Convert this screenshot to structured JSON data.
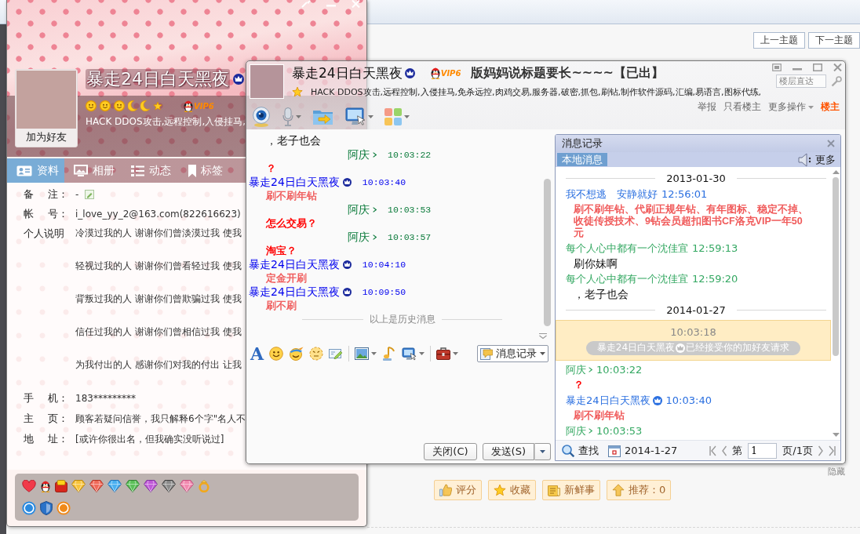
{
  "forum": {
    "nav_buttons": [
      {
        "label": "上一主题"
      },
      {
        "label": "下一主题"
      }
    ],
    "thread_title": "版妈妈说标题要长~~~~【已出】",
    "floor_jump": {
      "placeholder": "楼层直达"
    },
    "post_actions": [
      {
        "kind": "link",
        "label": "举报"
      },
      {
        "kind": "link",
        "label": "只看楼主"
      },
      {
        "kind": "menu",
        "label": "更多操作"
      },
      {
        "kind": "tag",
        "label": "楼主"
      }
    ],
    "hide_link": "隐藏",
    "action_buttons": [
      {
        "label": "评分"
      },
      {
        "label": "收藏"
      },
      {
        "label": "新鲜事"
      },
      {
        "label": "推荐：0"
      }
    ]
  },
  "profile": {
    "name": "暴走24日白天黑夜",
    "name_mark": true,
    "vip": "VIP6",
    "signature": "HACK DDOS攻击,远程控制,入侵挂马,",
    "add_friend": "加为好友",
    "tabs": [
      {
        "label": "资料",
        "selected": true
      },
      {
        "label": "相册",
        "selected": false
      },
      {
        "label": "动态",
        "selected": false
      },
      {
        "label": "标签",
        "selected": false
      }
    ],
    "fields": [
      {
        "kind": "remark",
        "label": "备 注：",
        "value": "-"
      },
      {
        "kind": "text",
        "label": "帐 号：",
        "value": "i_love_yy_2@163.com(822616623)"
      },
      {
        "kind": "lines",
        "label": "个人说明",
        "lines": [
          "冷漠过我的人 谢谢你们曾淡漠过我 使我",
          "轻视过我的人 谢谢你们曾看轻过我 使我",
          "背叛过我的人 谢谢你们曾欺骗过我 使我",
          "信任过我的人 谢谢你们曾相信过我 使我",
          "为我付出的人 感谢你们对我的付出 让我"
        ]
      },
      {
        "kind": "text",
        "label": "手 机：",
        "value": "183*********"
      },
      {
        "kind": "text",
        "label": "主 页：",
        "value": "顾客若疑问信誉，我只解释6个字\"名人不"
      },
      {
        "kind": "text",
        "label": "地 址：",
        "value": "[或许你很出名，但我确实没听说过]"
      }
    ]
  },
  "chat": {
    "contact": {
      "name": "暴走24日白天黑夜",
      "name_mark": true,
      "vip": "VIP6",
      "signature": "HACK DDOS攻击,远程控制,入侵挂马,免杀远控,肉鸡交易,服务器,破密,抓包,刷钻,制作软件源码,汇编,易语言,图标代练,"
    },
    "messages": [
      {
        "kind": "script",
        "text": "，老子也会"
      },
      {
        "kind": "header",
        "sender": "阿庆",
        "time": "10:03:22",
        "self": true,
        "name_mark": true
      },
      {
        "kind": "text",
        "text": "？",
        "color": "#ff0000"
      },
      {
        "kind": "header",
        "sender": "暴走24日白天黑夜",
        "time": "10:03:40",
        "self": false,
        "name_mark": true
      },
      {
        "kind": "text",
        "text": "刷不刷年钻",
        "color": "#f06060"
      },
      {
        "kind": "header",
        "sender": "阿庆",
        "time": "10:03:53",
        "self": true,
        "name_mark": true
      },
      {
        "kind": "text",
        "text": "怎么交易？",
        "color": "#ff0000"
      },
      {
        "kind": "header",
        "sender": "阿庆",
        "time": "10:03:57",
        "self": true,
        "name_mark": true
      },
      {
        "kind": "text",
        "text": "淘宝？",
        "color": "#ff0000"
      },
      {
        "kind": "header",
        "sender": "暴走24日白天黑夜",
        "time": "10:04:10",
        "self": false,
        "name_mark": true
      },
      {
        "kind": "text",
        "text": "定金开刷",
        "color": "#f06060"
      },
      {
        "kind": "header",
        "sender": "暴走24日白天黑夜",
        "time": "10:09:50",
        "self": false,
        "name_mark": true
      },
      {
        "kind": "text",
        "text": "刷不刷",
        "color": "#f06060"
      }
    ],
    "history_divider": "以上是历史消息",
    "font_button": "A",
    "history_button": "消息记录",
    "close_button": "关闭(C)",
    "send_button": "发送(S)",
    "history_panel": {
      "title": "消息记录",
      "tabs": [
        {
          "label": "本地消息",
          "selected": true
        }
      ],
      "more": "更多",
      "entries": [
        {
          "kind": "date",
          "text": "2013-01-30"
        },
        {
          "kind": "header",
          "sender": "我不想逃　安静就好",
          "time": "12:56:01",
          "self": false,
          "name_mark": false
        },
        {
          "kind": "text",
          "text": "刷不刷年钻、代刷正规年钻、有年图标、稳定不掉、收徒传授技术、9钻会员超扣图书CF洛克VIP一年50元",
          "color": "#f05a5a"
        },
        {
          "kind": "header",
          "sender": "每个人心中都有一个沈佳宜",
          "time": "12:59:13",
          "self": true,
          "name_mark": false
        },
        {
          "kind": "script",
          "text": "刷你妹啊"
        },
        {
          "kind": "header",
          "sender": "每个人心中都有一个沈佳宜",
          "time": "12:59:20",
          "self": true,
          "name_mark": false
        },
        {
          "kind": "script",
          "text": "，老子也会"
        },
        {
          "kind": "date",
          "text": "2014-01-27"
        },
        {
          "kind": "notice",
          "time": "10:03:18",
          "name": "暴走24日白天黑夜",
          "name_mark": true,
          "text": "已经接受你的加好友请求"
        },
        {
          "kind": "header",
          "sender": "阿庆",
          "time": "10:03:22",
          "self": true,
          "name_mark": true
        },
        {
          "kind": "text",
          "text": "？",
          "color": "#ff0000"
        },
        {
          "kind": "header",
          "sender": "暴走24日白天黑夜",
          "time": "10:03:40",
          "self": false,
          "name_mark": true
        },
        {
          "kind": "text",
          "text": "刷不刷年钻",
          "color": "#f05a5a"
        },
        {
          "kind": "header",
          "sender": "阿庆",
          "time": "10:03:53",
          "self": true,
          "name_mark": true
        }
      ],
      "search": "查找",
      "date": "2014-1-27",
      "page_prefix": "第",
      "page_field": {
        "value": "1"
      },
      "page_suffix": "页/1页"
    }
  }
}
